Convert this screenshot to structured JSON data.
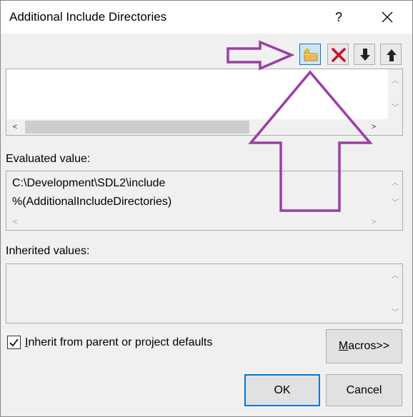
{
  "title": "Additional Include Directories",
  "titlebar": {
    "help_label": "?",
    "close_icon": "close-icon"
  },
  "toolbar": {
    "icons": [
      "new-folder-icon",
      "delete-icon",
      "move-down-icon",
      "move-up-icon"
    ]
  },
  "evaluated": {
    "label": "Evaluated value:",
    "lines": [
      "C:\\Development\\SDL2\\include",
      "%(AdditionalIncludeDirectories)"
    ]
  },
  "inherited": {
    "label": "Inherited values:"
  },
  "checkbox": {
    "label": "Inherit from parent or project defaults",
    "checked": true
  },
  "buttons": {
    "macros": "Macros>>",
    "ok": "OK",
    "cancel": "Cancel"
  },
  "colors": {
    "accent": "#0078d7",
    "annotation": "#9b3ea6",
    "delete": "#c8102e"
  }
}
